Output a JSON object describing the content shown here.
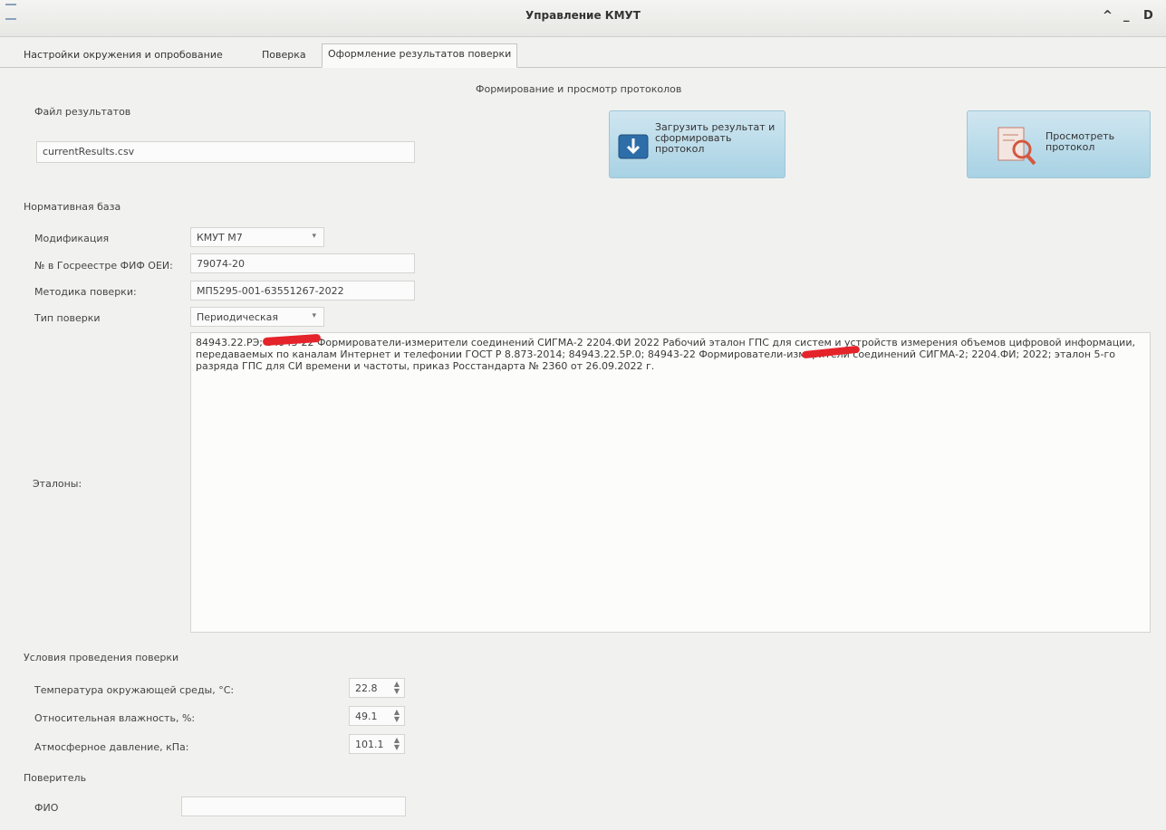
{
  "window": {
    "title": "Управление КМУТ",
    "controls": {
      "up": "^",
      "min": "_",
      "max": "D"
    }
  },
  "tabs": [
    {
      "label": "Настройки окружения и опробование"
    },
    {
      "label": "Поверка"
    },
    {
      "label": "Оформление результатов поверки"
    }
  ],
  "header": "Формирование и просмотр протоколов",
  "results": {
    "label": "Файл результатов",
    "file": "currentResults.csv"
  },
  "buttons": {
    "load": "Загрузить результат и сформировать протокол",
    "view": "Просмотреть протокол"
  },
  "normative": {
    "section": "Нормативная база",
    "modification_label": "Модификация",
    "modification_value": "КМУТ М7",
    "registry_label": "№ в Госреестре ФИФ ОЕИ:",
    "registry_value": "79074-20",
    "method_label": "Методика поверки:",
    "method_value": "МП5295-001-63551267-2022",
    "type_label": "Тип поверки",
    "type_value": "Периодическая",
    "etalons_label": "Эталоны:",
    "etalons_text": "84943.22.РЭ; 84943-22 Формирователи-измерители соединений СИГМА-2 2204.ФИ 2022 Рабочий эталон ГПС для систем и устройств измерения объемов цифровой информации, передаваемых по каналам Интернет и телефонии ГОСТ Р 8.873-2014; 84943.22.5Р.0; 84943-22 Формирователи-измерители соединений СИГМА-2; 2204.ФИ; 2022; эталон 5-го разряда ГПС для СИ времени и частоты, приказ Росстандарта № 2360 от 26.09.2022 г."
  },
  "conditions": {
    "section": "Условия проведения поверки",
    "temp_label": "Температура окружающей среды, °С:",
    "temp_value": "22.8",
    "humidity_label": "Относительная влажность, %:",
    "humidity_value": "49.1",
    "pressure_label": "Атмосферное давление, кПа:",
    "pressure_value": "101.1"
  },
  "verifier": {
    "section": "Поверитель",
    "name_label": "ФИО",
    "name_value": ""
  },
  "colors": {
    "button": "#a8d2e4",
    "redaction": "#e5232a"
  }
}
